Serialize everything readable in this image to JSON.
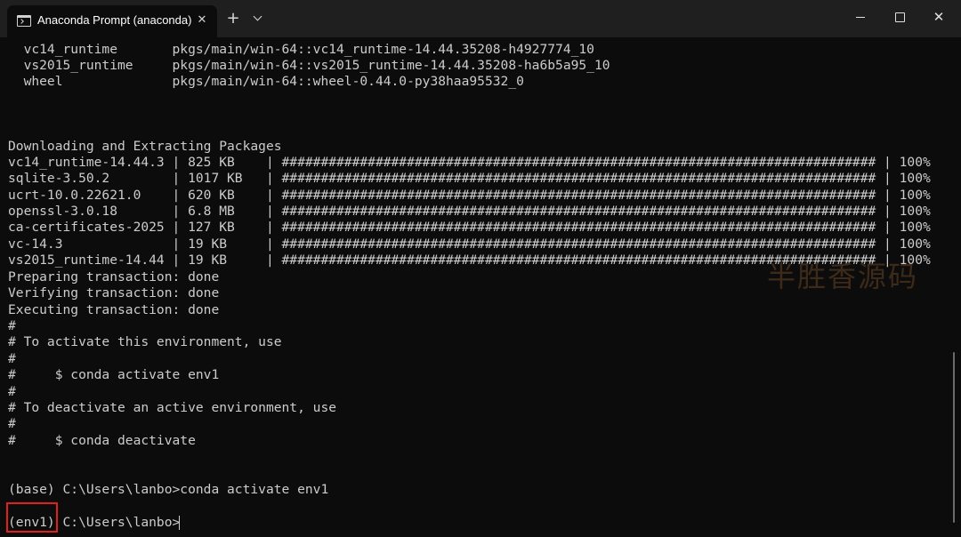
{
  "window": {
    "tab_title": "Anaconda Prompt (anaconda)",
    "new_tab_label": "+",
    "tab_close_label": "✕",
    "close_label": "✕"
  },
  "terminal": {
    "lines": [
      "  vc14_runtime       pkgs/main/win-64::vc14_runtime-14.44.35208-h4927774_10",
      "  vs2015_runtime     pkgs/main/win-64::vs2015_runtime-14.44.35208-ha6b5a95_10",
      "  wheel              pkgs/main/win-64::wheel-0.44.0-py38haa95532_0",
      "",
      "",
      "Downloading and Extracting Packages",
      "vc14_runtime-14.44.3 | 825 KB    | ############################################################################ | 100%",
      "sqlite-3.50.2        | 1017 KB   | ############################################################################ | 100%",
      "ucrt-10.0.22621.0    | 620 KB    | ############################################################################ | 100%",
      "openssl-3.0.18       | 6.8 MB    | ############################################################################ | 100%",
      "ca-certificates-2025 | 127 KB    | ############################################################################ | 100%",
      "vc-14.3              | 19 KB     | ############################################################################ | 100%",
      "vs2015_runtime-14.44 | 19 KB     | ############################################################################ | 100%",
      "Preparing transaction: done",
      "Verifying transaction: done",
      "Executing transaction: done",
      "#",
      "# To activate this environment, use",
      "#",
      "#     $ conda activate env1",
      "#",
      "# To deactivate an active environment, use",
      "#",
      "#     $ conda deactivate",
      "",
      "",
      "(base) C:\\Users\\lanbo>conda activate env1",
      "",
      "(env1) C:\\Users\\lanbo>"
    ],
    "watermark": "半胜香源码"
  }
}
